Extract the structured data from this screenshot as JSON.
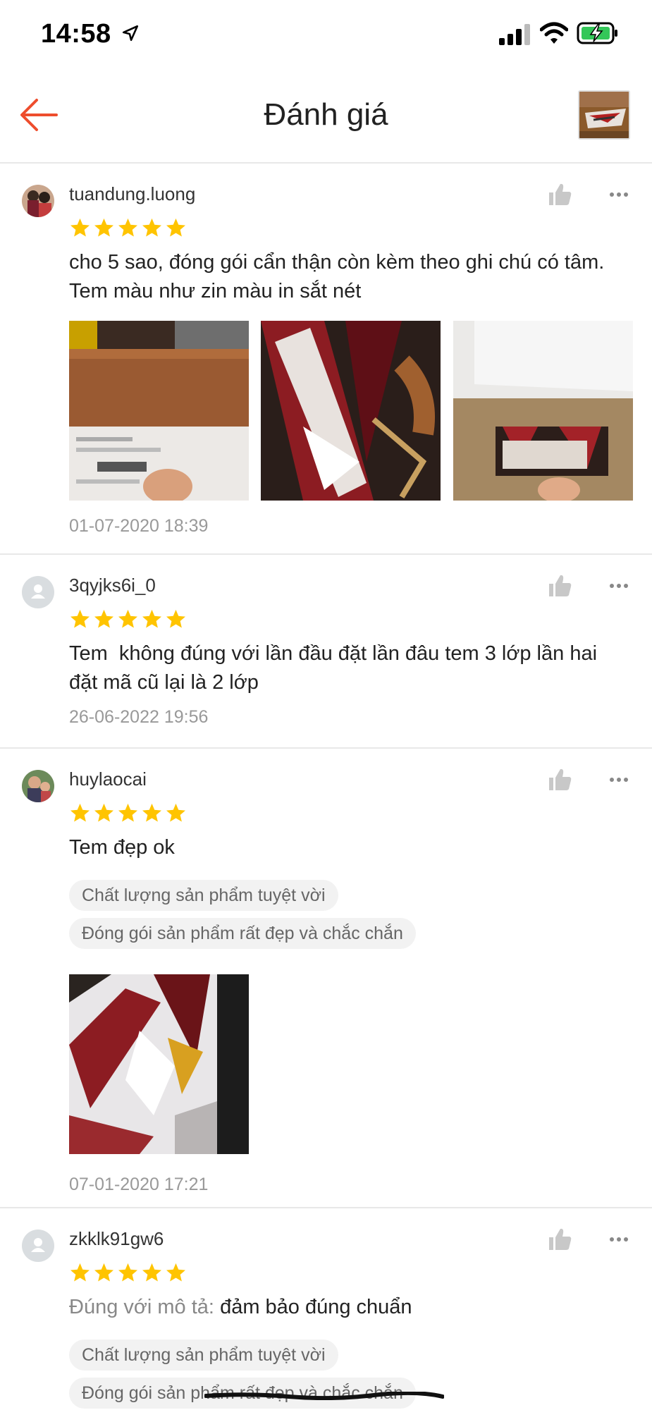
{
  "status_bar": {
    "time": "14:58"
  },
  "header": {
    "title": "Đánh giá"
  },
  "reviews": [
    {
      "username": "tuandung.luong",
      "rating": 5,
      "comment": "cho 5 sao, đóng gói cẩn thận còn kèm theo ghi chú có tâm. Tem màu như zin màu in sắt nét",
      "photo_count": 3,
      "date": "01-07-2020 18:39"
    },
    {
      "username": "3qyjks6i_0",
      "rating": 5,
      "comment": "Tem  không đúng với lần đầu đặt lần đâu tem 3 lớp lần hai đặt mã cũ lại là 2 lớp",
      "date": "26-06-2022 19:56"
    },
    {
      "username": "huylaocai",
      "rating": 5,
      "comment": "Tem đẹp ok",
      "tags": [
        "Chất lượng sản phẩm tuyệt vời",
        "Đóng gói sản phẩm rất đẹp và chắc chắn"
      ],
      "photo_count": 1,
      "date": "07-01-2020 17:21"
    },
    {
      "username": "zkklk91gw6",
      "rating": 5,
      "comment_label": "Đúng với mô tả:",
      "comment_value": "đảm bảo đúng chuẩn",
      "tags": [
        "Chất lượng sản phẩm tuyệt vời",
        "Đóng gói sản phẩm rất đẹp và chắc chắn"
      ]
    }
  ],
  "colors": {
    "accent": "#ee4d2d",
    "star": "#ffc400",
    "muted_text": "#999999",
    "tag_bg": "#f2f2f2"
  }
}
